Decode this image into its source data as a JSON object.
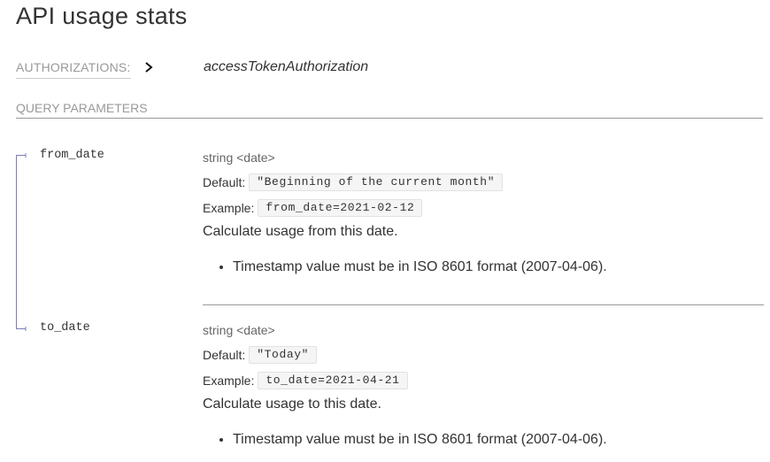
{
  "page": {
    "title": "API usage stats"
  },
  "authorizations": {
    "label": "AUTHORIZATIONS:",
    "value": "accessTokenAuthorization"
  },
  "query_parameters": {
    "header": "QUERY PARAMETERS",
    "params": [
      {
        "name": "from_date",
        "type": "string <date>",
        "default_label": "Default:",
        "default_value": "\"Beginning of the current month\"",
        "example_label": "Example:",
        "example_value": "from_date=2021-02-12",
        "description": "Calculate usage from this date.",
        "bullets": [
          "Timestamp value must be in ISO 8601 format (2007-04-06)."
        ]
      },
      {
        "name": "to_date",
        "type": "string <date>",
        "default_label": "Default:",
        "default_value": "\"Today\"",
        "example_label": "Example:",
        "example_value": "to_date=2021-04-21",
        "description": "Calculate usage to this date.",
        "bullets": [
          "Timestamp value must be in ISO 8601 format (2007-04-06)."
        ]
      }
    ]
  },
  "colors": {
    "tree_line": "#7c7cbb",
    "muted_text": "#999999",
    "body_text": "#333333"
  },
  "icons": {
    "authorizations_toggle": "chevron-right-icon"
  }
}
